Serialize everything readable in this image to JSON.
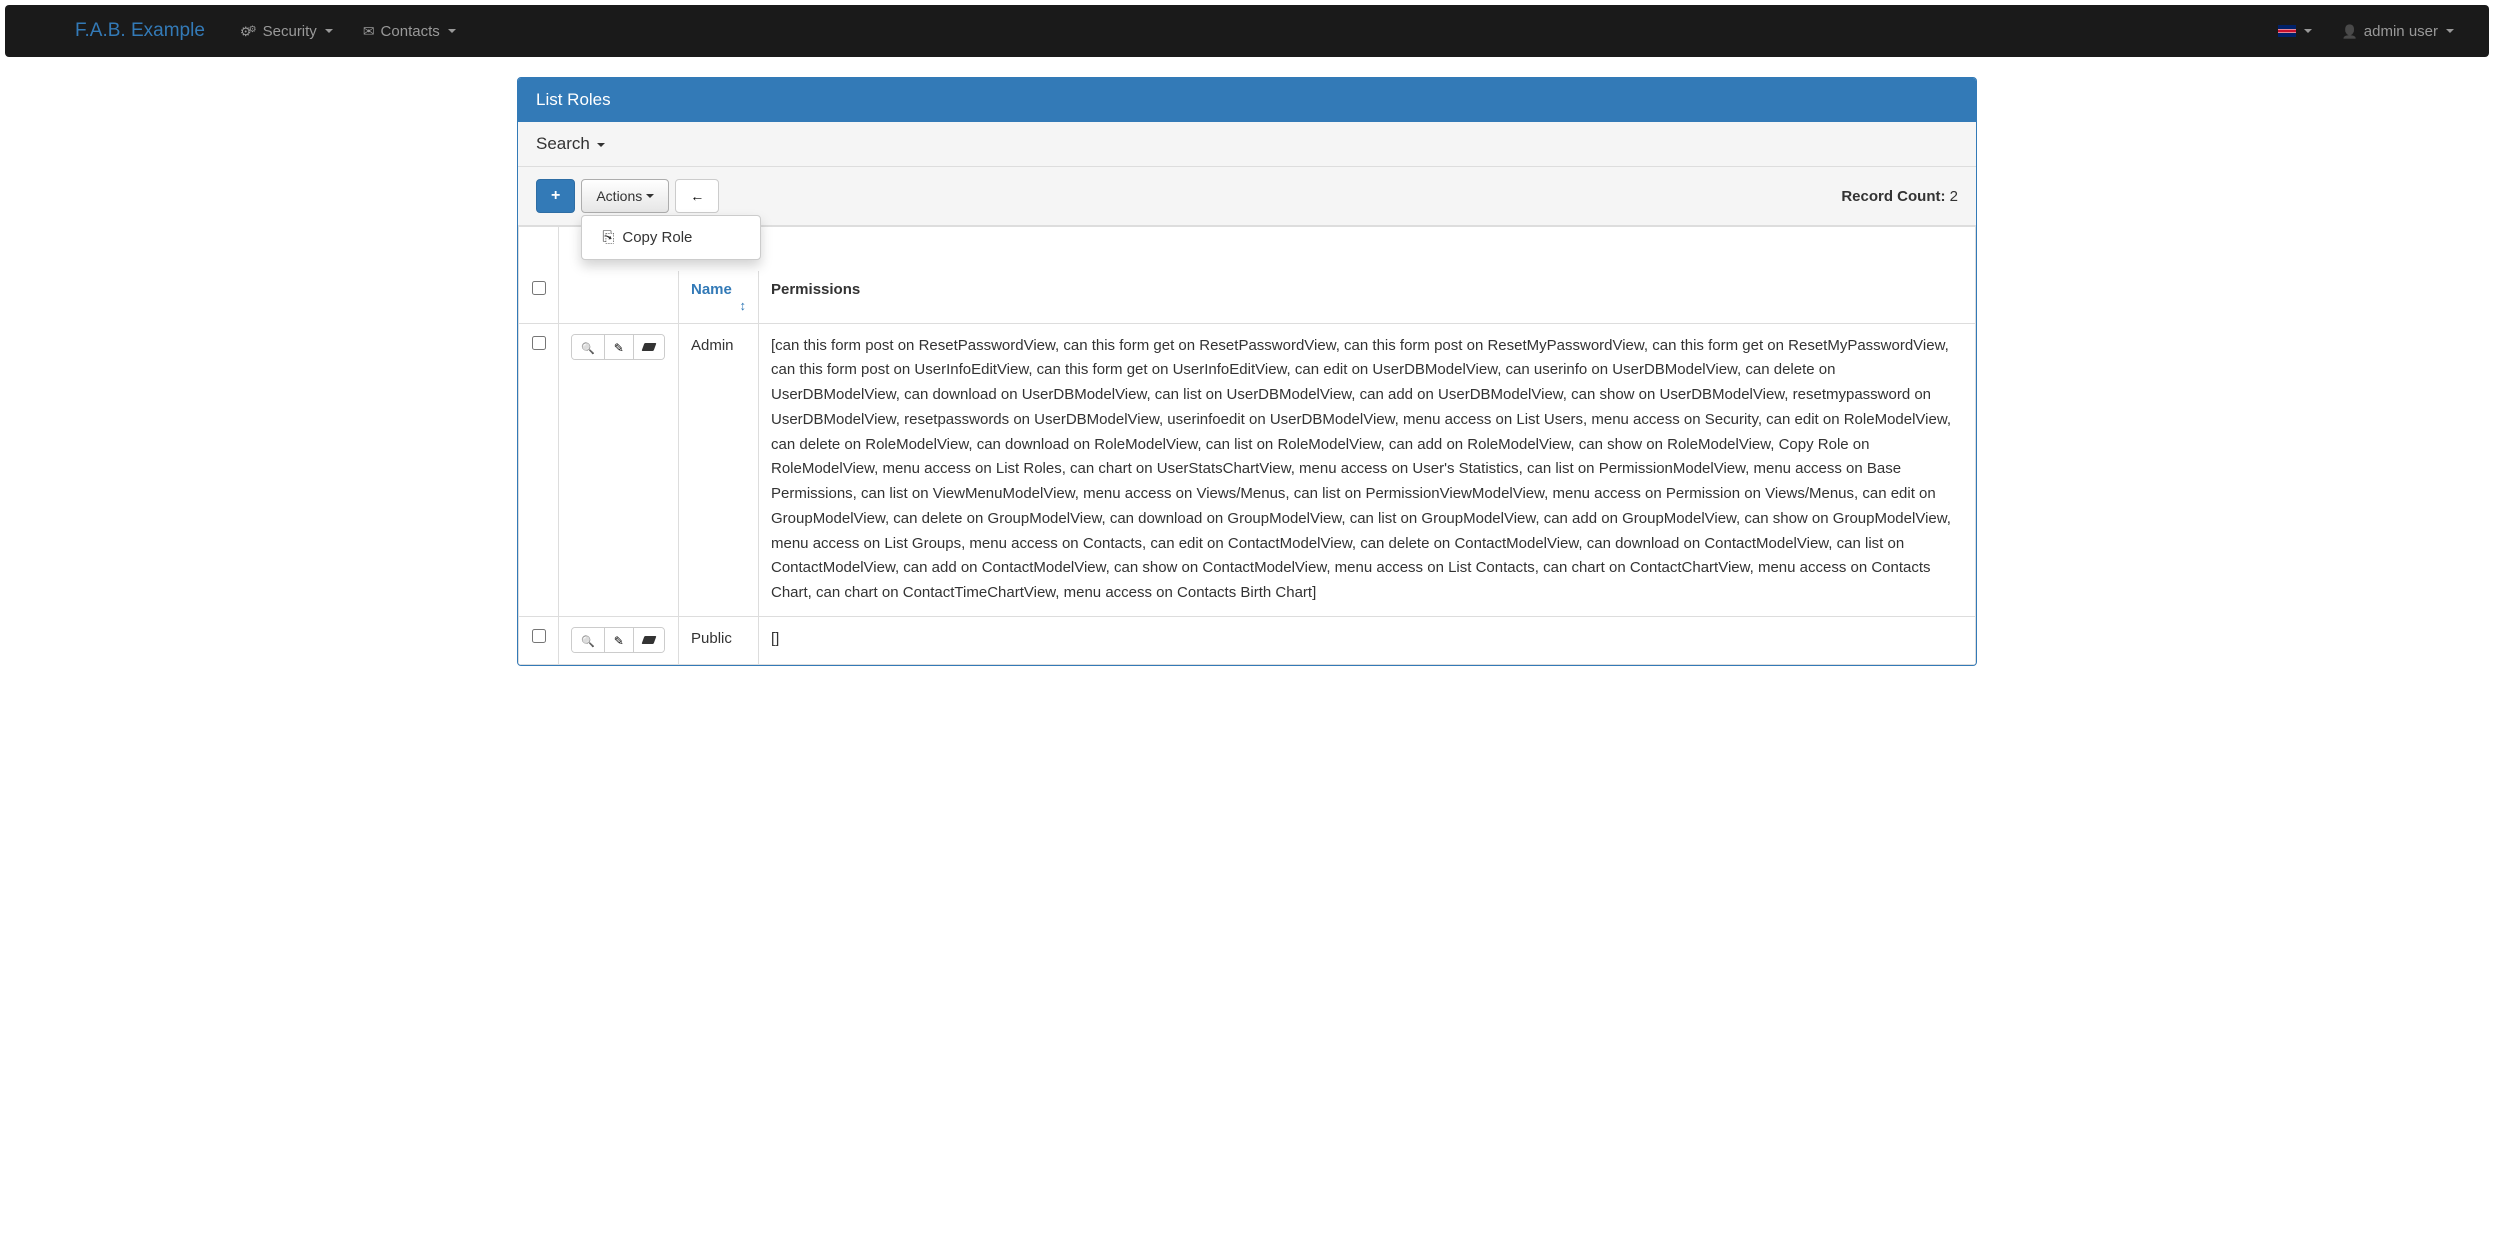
{
  "navbar": {
    "brand": "F.A.B. Example",
    "menu": {
      "security": "Security",
      "contacts": "Contacts"
    },
    "user": "admin user"
  },
  "panel": {
    "title": "List Roles"
  },
  "search": {
    "label": "Search"
  },
  "toolbar": {
    "actions_label": "Actions",
    "record_count_label": "Record Count:",
    "record_count_value": "2",
    "dropdown": {
      "copy_role": "Copy Role"
    }
  },
  "table": {
    "headers": {
      "name": "Name",
      "permissions": "Permissions"
    },
    "rows": [
      {
        "name": "Admin",
        "permissions": "[can this form post on ResetPasswordView, can this form get on ResetPasswordView, can this form post on ResetMyPasswordView, can this form get on ResetMyPasswordView, can this form post on UserInfoEditView, can this form get on UserInfoEditView, can edit on UserDBModelView, can userinfo on UserDBModelView, can delete on UserDBModelView, can download on UserDBModelView, can list on UserDBModelView, can add on UserDBModelView, can show on UserDBModelView, resetmypassword on UserDBModelView, resetpasswords on UserDBModelView, userinfoedit on UserDBModelView, menu access on List Users, menu access on Security, can edit on RoleModelView, can delete on RoleModelView, can download on RoleModelView, can list on RoleModelView, can add on RoleModelView, can show on RoleModelView, Copy Role on RoleModelView, menu access on List Roles, can chart on UserStatsChartView, menu access on User's Statistics, can list on PermissionModelView, menu access on Base Permissions, can list on ViewMenuModelView, menu access on Views/Menus, can list on PermissionViewModelView, menu access on Permission on Views/Menus, can edit on GroupModelView, can delete on GroupModelView, can download on GroupModelView, can list on GroupModelView, can add on GroupModelView, can show on GroupModelView, menu access on List Groups, menu access on Contacts, can edit on ContactModelView, can delete on ContactModelView, can download on ContactModelView, can list on ContactModelView, can add on ContactModelView, can show on ContactModelView, menu access on List Contacts, can chart on ContactChartView, menu access on Contacts Chart, can chart on ContactTimeChartView, menu access on Contacts Birth Chart]"
      },
      {
        "name": "Public",
        "permissions": "[]"
      }
    ]
  }
}
